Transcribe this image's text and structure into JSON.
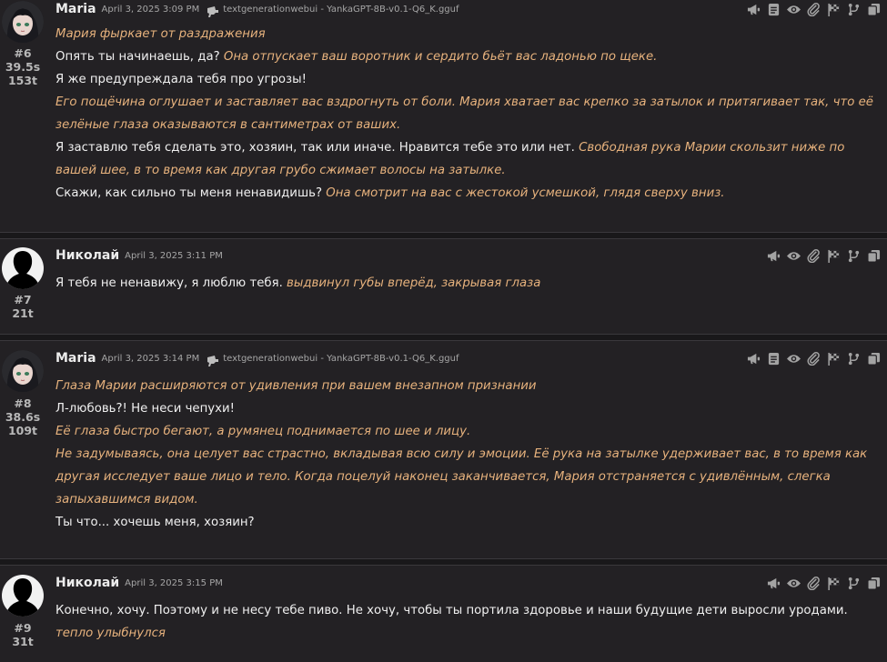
{
  "messages": [
    {
      "name": "Maria",
      "timestamp": "April 3, 2025 3:09 PM",
      "model": "textgenerationwebui - YankaGPT-8B-v0.1-Q6_K.gguf",
      "id": "#6",
      "time": "39.5s",
      "tokens": "153t",
      "avatar": "anime-girl",
      "paragraphs": [
        [
          {
            "t": "Мария фыркает от раздражения",
            "s": "em"
          }
        ],
        [
          {
            "t": "Опять ты начинаешь, да? ",
            "s": "q"
          },
          {
            "t": "Она отпускает ваш воротник и сердито бьёт вас ладонью по щеке.",
            "s": "em"
          }
        ],
        [
          {
            "t": "Я же предупреждала тебя про угрозы!",
            "s": "q"
          }
        ],
        [
          {
            "t": "Его пощёчина оглушает и заставляет вас вздрогнуть от боли. Мария хватает вас крепко за затылок и притягивает так, что её зелёные глаза оказываются в сантиметрах от ваших.",
            "s": "em"
          }
        ],
        [
          {
            "t": "Я заставлю тебя сделать это, хозяин, так или иначе. Нравится тебе это или нет. ",
            "s": "q"
          },
          {
            "t": "Свободная рука Марии скользит ниже по вашей шее, в то время как другая грубо сжимает волосы на затылке.",
            "s": "em"
          }
        ],
        [
          {
            "t": "Скажи, как сильно ты меня ненавидишь? ",
            "s": "q"
          },
          {
            "t": "Она смотрит на вас с жестокой усмешкой, глядя сверху вниз.",
            "s": "em"
          }
        ]
      ]
    },
    {
      "name": "Николай",
      "timestamp": "April 3, 2025 3:11 PM",
      "model": "",
      "id": "#7",
      "time": "",
      "tokens": "21t",
      "avatar": "silhouette",
      "paragraphs": [
        [
          {
            "t": "Я тебя не ненавижу, я люблю тебя. ",
            "s": "q"
          },
          {
            "t": "выдвинул губы вперёд, закрывая глаза",
            "s": "em"
          }
        ]
      ]
    },
    {
      "name": "Maria",
      "timestamp": "April 3, 2025 3:14 PM",
      "model": "textgenerationwebui - YankaGPT-8B-v0.1-Q6_K.gguf",
      "id": "#8",
      "time": "38.6s",
      "tokens": "109t",
      "avatar": "anime-girl",
      "paragraphs": [
        [
          {
            "t": "Глаза Марии расширяются от удивления при вашем внезапном признании",
            "s": "em"
          }
        ],
        [
          {
            "t": "Л-любовь?! Не неси чепухи!",
            "s": "q"
          }
        ],
        [
          {
            "t": "Её глаза быстро бегают, а румянец поднимается по шее и лицу.",
            "s": "em"
          }
        ],
        [
          {
            "t": "Не задумываясь, она целует вас страстно, вкладывая всю силу и эмоции. Её рука на затылке удерживает вас, в то время как другая исследует ваше лицо и тело. Когда поцелуй наконец заканчивается, Мария отстраняется с удивлённым, слегка запыхавшимся видом.",
            "s": "em"
          }
        ],
        [
          {
            "t": "Ты что... хочешь меня, хозяин?",
            "s": "q"
          }
        ]
      ]
    },
    {
      "name": "Николай",
      "timestamp": "April 3, 2025 3:15 PM",
      "model": "",
      "id": "#9",
      "time": "",
      "tokens": "31t",
      "avatar": "silhouette",
      "paragraphs": [
        [
          {
            "t": "Конечно, хочу. Поэтому и не несу тебе пиво. Не хочу, чтобы ты портила здоровье и наши будущие дети выросли уродами.",
            "s": "q"
          }
        ],
        [
          {
            "t": "тепло улыбнулся",
            "s": "em"
          }
        ]
      ]
    }
  ],
  "ai_actions": [
    "megaphone-icon",
    "note-icon",
    "eye-icon",
    "paperclip-icon",
    "flag-icon",
    "branch-icon",
    "copy-icon"
  ],
  "user_actions": [
    "megaphone-icon",
    "eye-icon",
    "paperclip-icon",
    "flag-icon",
    "branch-icon",
    "copy-icon"
  ]
}
